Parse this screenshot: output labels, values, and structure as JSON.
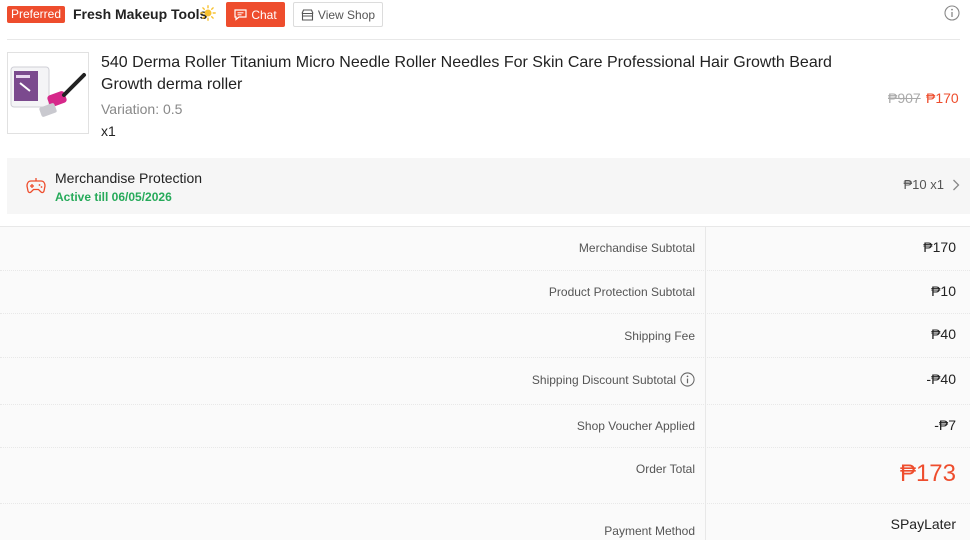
{
  "shop": {
    "badge": "Preferred",
    "name": "Fresh Makeup Tools",
    "chat_label": "Chat",
    "view_shop_label": "View Shop"
  },
  "product": {
    "title": "540 Derma Roller Titanium Micro Needle Roller Needles For Skin Care Professional Hair Growth Beard Growth derma roller",
    "variation": "Variation: 0.5",
    "quantity": "x1",
    "original_price": "₱907",
    "price": "₱170"
  },
  "protection": {
    "title": "Merchandise Protection",
    "active": "Active till 06/05/2026",
    "price": "₱10 x1"
  },
  "summary": {
    "merch_label": "Merchandise Subtotal",
    "merch_value": "₱170",
    "prot_label": "Product Protection Subtotal",
    "prot_value": "₱10",
    "ship_label": "Shipping Fee",
    "ship_value": "₱40",
    "shipdisc_label": "Shipping Discount Subtotal",
    "shipdisc_value": "-₱40",
    "voucher_label": "Shop Voucher Applied",
    "voucher_value": "-₱7",
    "total_label": "Order Total",
    "total_value": "₱173",
    "payment_label": "Payment Method",
    "payment_value": "SPayLater"
  },
  "colors": {
    "accent": "#ee4d2d",
    "active_green": "#26aa5a"
  },
  "icons": [
    "sun-icon",
    "chat-icon",
    "shop-icon",
    "info-icon",
    "gamepad-icon",
    "chevron-right-icon"
  ]
}
